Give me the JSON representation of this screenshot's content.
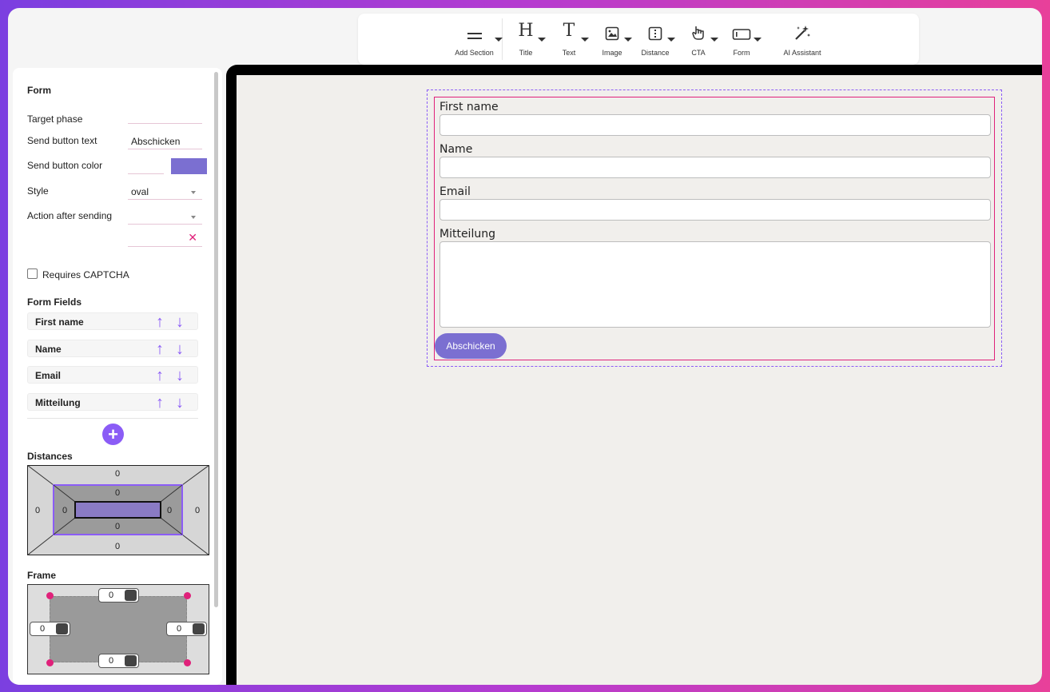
{
  "toolbar": {
    "items": [
      {
        "label": "Add Section",
        "icon": "equals-icon"
      },
      {
        "label": "Title",
        "icon": "heading-icon"
      },
      {
        "label": "Text",
        "icon": "text-icon"
      },
      {
        "label": "Image",
        "icon": "image-icon"
      },
      {
        "label": "Distance",
        "icon": "distance-icon"
      },
      {
        "label": "CTA",
        "icon": "pointer-hand-icon"
      },
      {
        "label": "Form",
        "icon": "form-icon"
      },
      {
        "label": "AI Assistant",
        "icon": "magic-wand-icon"
      }
    ],
    "glyphs": {
      "title": "H",
      "text": "T"
    }
  },
  "panel": {
    "section_title": "Form",
    "target_phase_label": "Target phase",
    "target_phase_value": "",
    "send_button_text_label": "Send button text",
    "send_button_text_value": "Abschicken",
    "send_button_color_label": "Send button color",
    "send_button_color": "#7b6fd1",
    "style_label": "Style",
    "style_value": "oval",
    "action_label": "Action after sending",
    "action_value": "",
    "clear_glyph": "✕",
    "captcha_label": "Requires CAPTCHA",
    "captcha_checked": false,
    "form_fields_title": "Form Fields",
    "form_fields": [
      "First name",
      "Name",
      "Email",
      "Mitteilung"
    ],
    "arrow_up": "↑",
    "arrow_down": "↓",
    "add_glyph": "+",
    "distances_title": "Distances",
    "distances": {
      "outer_top": "0",
      "outer_left": "0",
      "outer_right": "0",
      "outer_bottom": "0",
      "inner_top": "0",
      "inner_left": "0",
      "inner_right": "0",
      "inner_bottom": "0"
    },
    "frame_title": "Frame",
    "frame": {
      "top": "0",
      "left": "0",
      "right": "0",
      "bottom": "0"
    }
  },
  "canvas": {
    "fields": [
      {
        "label": "First name"
      },
      {
        "label": "Name"
      },
      {
        "label": "Email"
      },
      {
        "label": "Mitteilung"
      }
    ],
    "submit_label": "Abschicken"
  },
  "colors": {
    "accent": "#8b5cf6",
    "pink": "#e0217a",
    "button": "#7b6fd1"
  }
}
